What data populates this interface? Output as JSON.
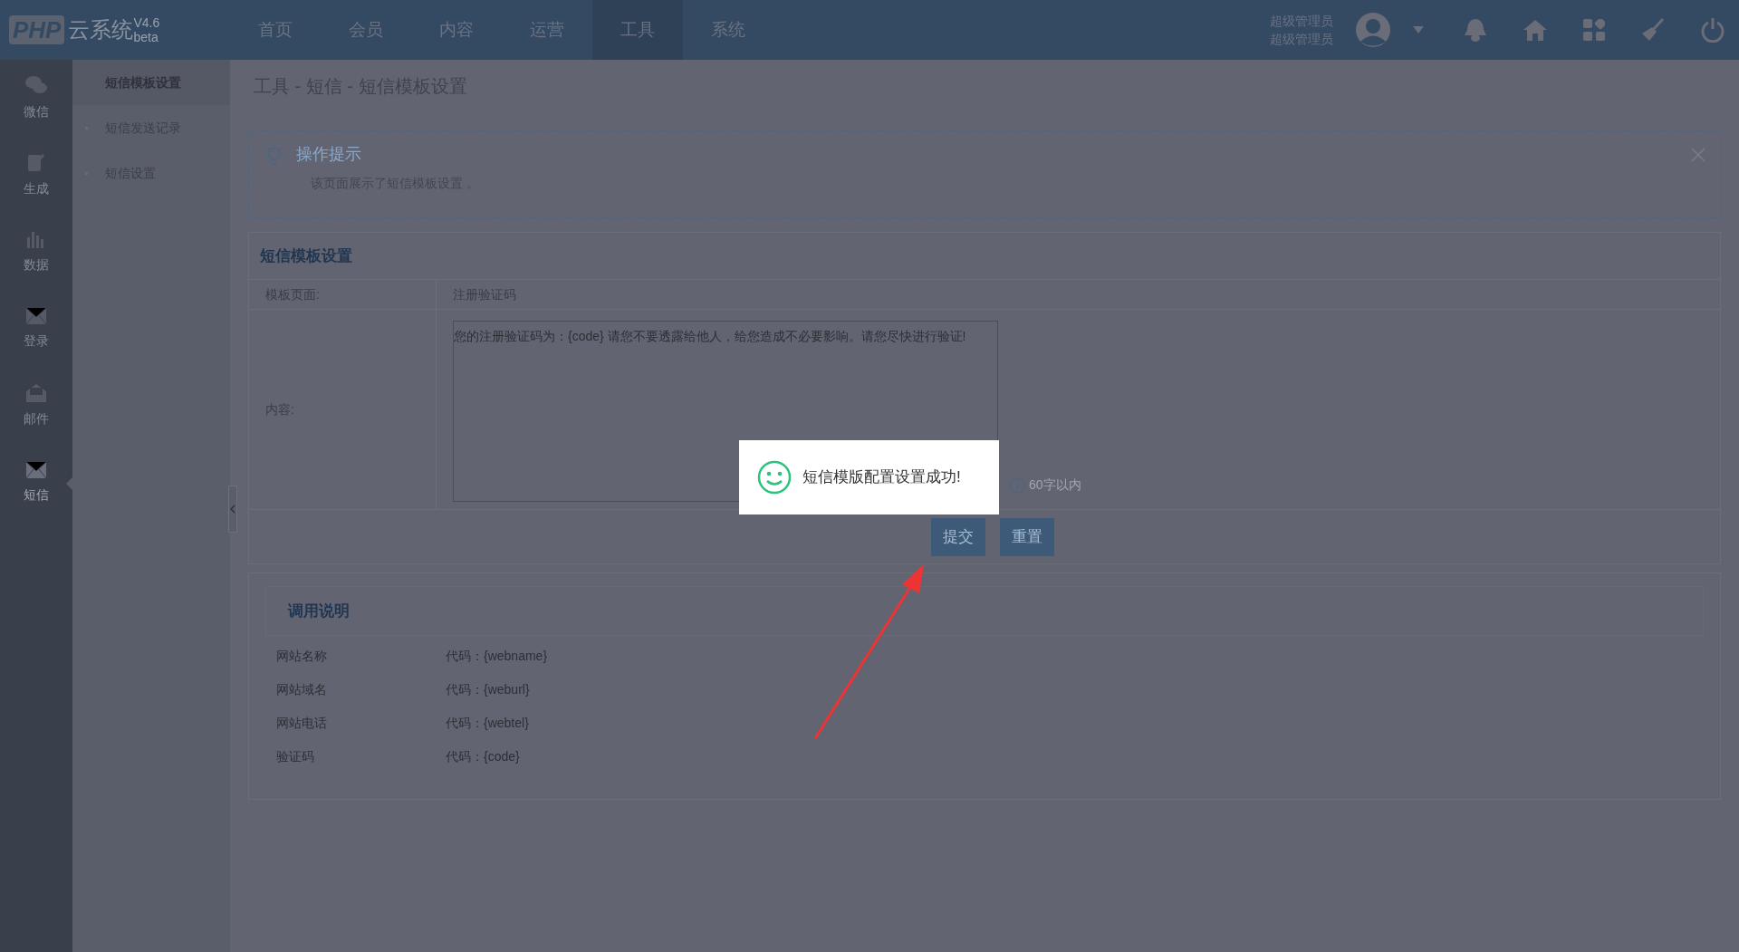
{
  "header": {
    "logo": "PHP",
    "brand": "云系统",
    "version": "V4.6",
    "tag": "beta",
    "nav": [
      {
        "label": "首页",
        "selected": false
      },
      {
        "label": "会员",
        "selected": false
      },
      {
        "label": "内容",
        "selected": false
      },
      {
        "label": "运营",
        "selected": false
      },
      {
        "label": "工具",
        "selected": true
      },
      {
        "label": "系统",
        "selected": false
      }
    ],
    "user": [
      "超级管理员",
      "超级管理员"
    ]
  },
  "sidebar": [
    {
      "label": "微信",
      "selected": false
    },
    {
      "label": "生成",
      "selected": false
    },
    {
      "label": "数据",
      "selected": false
    },
    {
      "label": "登录",
      "selected": false
    },
    {
      "label": "邮件",
      "selected": false
    },
    {
      "label": "短信",
      "selected": true
    }
  ],
  "submenu": [
    {
      "label": "短信模板设置",
      "selected": true
    },
    {
      "label": "短信发送记录",
      "selected": false
    },
    {
      "label": "短信设置",
      "selected": false
    }
  ],
  "breadcrumb": "工具 - 短信 - 短信模板设置",
  "tip": {
    "title": "操作提示",
    "items": [
      "该页面展示了短信模板设置 。"
    ]
  },
  "form": {
    "title": "短信模板设置",
    "rows": [
      {
        "kind": "text",
        "label": "模板页面:",
        "value": "注册验证码"
      },
      {
        "kind": "textarea",
        "label": "内容:",
        "value": "您的注册验证码为：{code} 请您不要透露给他人，给您造成不必要影响。请您尽快进行验证!",
        "hint": "60字以内"
      }
    ],
    "buttons": [
      "提交",
      "重置"
    ]
  },
  "usage": {
    "title": "调用说明",
    "rows": [
      {
        "name": "网站名称",
        "code": "代码：{webname}"
      },
      {
        "name": "网站域名",
        "code": "代码：{weburl}"
      },
      {
        "name": "网站电话",
        "code": "代码：{webtel}"
      },
      {
        "name": "验证码",
        "code": "代码：{code}"
      }
    ]
  },
  "toast": {
    "message": "短信模版配置设置成功!"
  }
}
